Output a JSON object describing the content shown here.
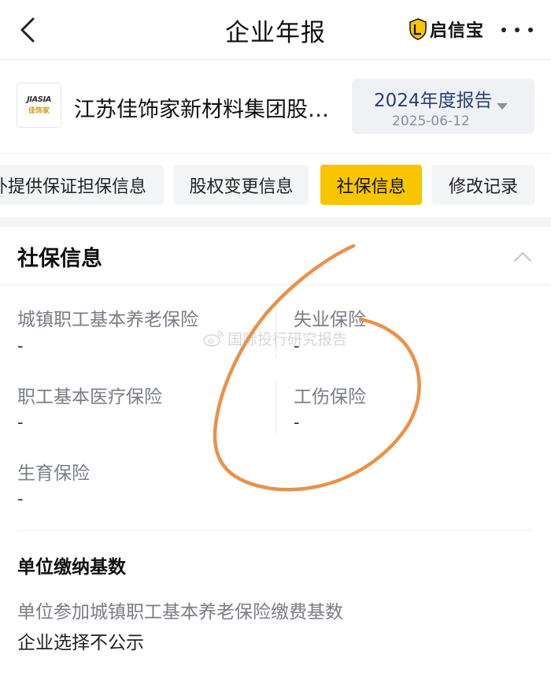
{
  "header": {
    "title": "企业年报",
    "brand": "启信宝",
    "back_icon": "chevron-left-icon",
    "more_icon": "more-dots-icon"
  },
  "company": {
    "logo_text_top": "JIASIA",
    "logo_text_bottom": "佳饰家",
    "name": "江苏佳饰家新材料集团股…",
    "report": {
      "year_label": "2024年度报告",
      "date": "2025-06-12"
    }
  },
  "tabs": [
    {
      "label": "外提供保证担保信息",
      "active": false
    },
    {
      "label": "股权变更信息",
      "active": false
    },
    {
      "label": "社保信息",
      "active": true
    },
    {
      "label": "修改记录",
      "active": false
    }
  ],
  "section": {
    "title": "社保信息",
    "collapse_icon": "chevron-up-icon",
    "fields": [
      {
        "label": "城镇职工基本养老保险",
        "value": "-"
      },
      {
        "label": "失业保险",
        "value": "-"
      },
      {
        "label": "职工基本医疗保险",
        "value": "-"
      },
      {
        "label": "工伤保险",
        "value": "-"
      },
      {
        "label": "生育保险",
        "value": "-"
      }
    ],
    "base": {
      "title": "单位缴纳基数",
      "label": "单位参加城镇职工基本养老保险缴费基数",
      "value": "企业选择不公示"
    }
  },
  "watermark": {
    "text": "国际投行研究报告"
  },
  "colors": {
    "accent": "#f7c600",
    "report_text": "#2a3f78",
    "muted_text": "#7a7d86",
    "annotation": "#e8893a"
  }
}
